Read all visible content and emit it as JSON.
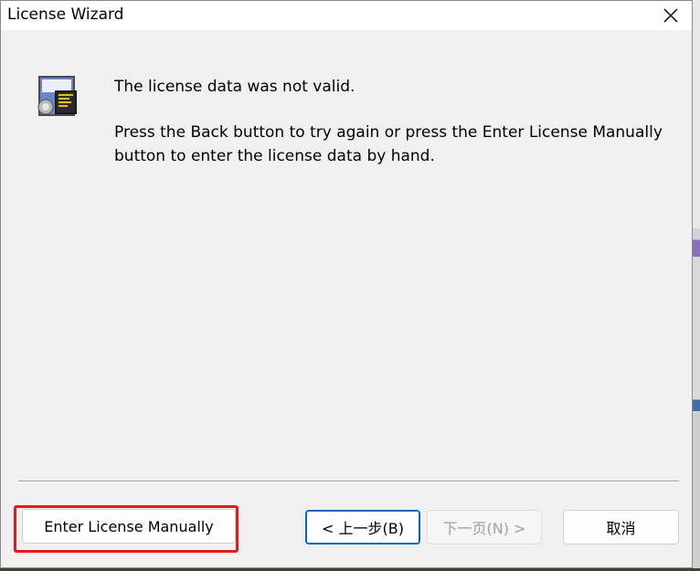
{
  "window": {
    "title": "License Wizard"
  },
  "icons": {
    "close": "close-icon",
    "wizard": "license-certificate-icon"
  },
  "message": {
    "line1": "The license data was not valid.",
    "line2": "Press the Back button to try again or press the Enter License Manually button to enter the license data by hand."
  },
  "buttons": {
    "enter_manually": "Enter License Manually",
    "back": "< 上一步(B)",
    "next": "下一页(N) >",
    "cancel": "取消"
  },
  "colors": {
    "highlight": "#e8191e",
    "focus": "#0067c0"
  }
}
